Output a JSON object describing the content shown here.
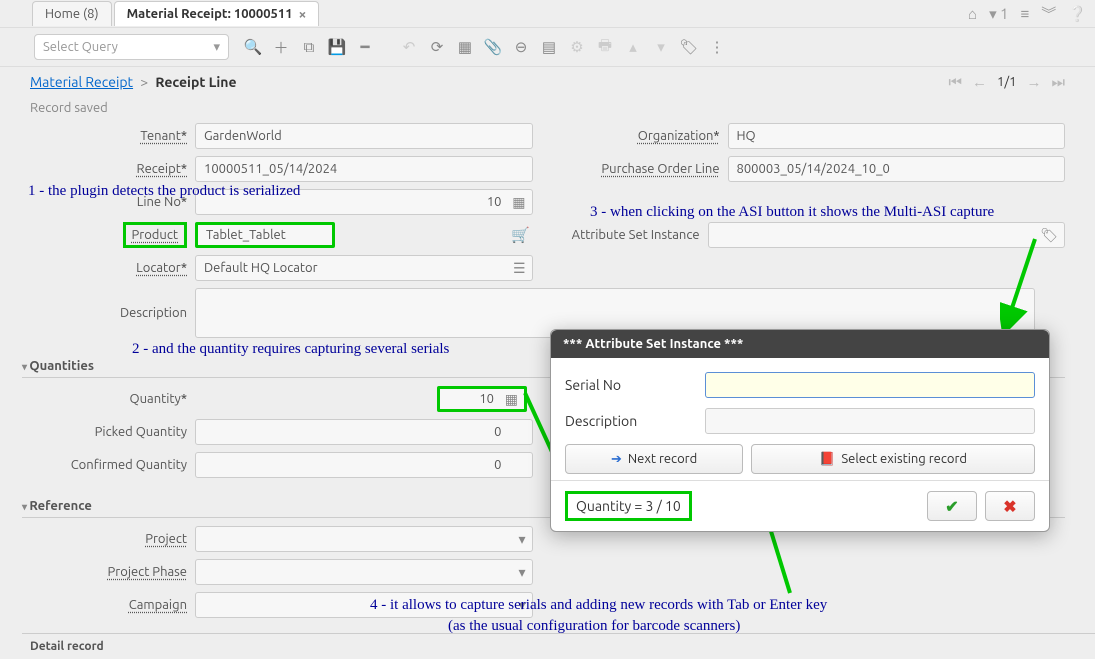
{
  "tabs": {
    "home": "Home (8)",
    "active": "Material Receipt: 10000511"
  },
  "toolbar": {
    "query_placeholder": "Select Query"
  },
  "breadcrumb": {
    "root": "Material Receipt",
    "current": "Receipt Line",
    "page": "1/1"
  },
  "status": "Record saved",
  "fields": {
    "tenant_label": "Tenant",
    "tenant": "GardenWorld",
    "org_label": "Organization",
    "org": "HQ",
    "receipt_label": "Receipt",
    "receipt": "10000511_05/14/2024",
    "pol_label": "Purchase Order Line",
    "pol": "800003_05/14/2024_10_0",
    "lineno_label": "Line No",
    "lineno": "10",
    "product_label": "Product",
    "product": "Tablet_Tablet",
    "asi_label": "Attribute Set Instance",
    "locator_label": "Locator",
    "locator": "Default HQ Locator",
    "desc_label": "Description"
  },
  "sections": {
    "quantities": "Quantities",
    "reference": "Reference"
  },
  "qty": {
    "quantity_label": "Quantity",
    "quantity": "10",
    "picked_label": "Picked Quantity",
    "picked": "0",
    "confirmed_label": "Confirmed Quantity",
    "confirmed": "0"
  },
  "ref": {
    "project_label": "Project",
    "phase_label": "Project Phase",
    "campaign_label": "Campaign"
  },
  "annotations": {
    "a1": "1 - the plugin detects the product is serialized",
    "a2": "2 - and the quantity requires capturing several serials",
    "a3": "3 - when clicking on the ASI button it shows the Multi-ASI capture",
    "a4a": "4 - it allows to capture serials and adding new records with Tab or Enter key",
    "a4b": "(as the usual configuration for barcode scanners)"
  },
  "dialog": {
    "title": "*** Attribute Set Instance ***",
    "serial_label": "Serial No",
    "desc_label": "Description",
    "next_btn": "Next record",
    "select_btn": "Select existing record",
    "counter": "Quantity = 3 / 10"
  },
  "detail_bar": "Detail record"
}
